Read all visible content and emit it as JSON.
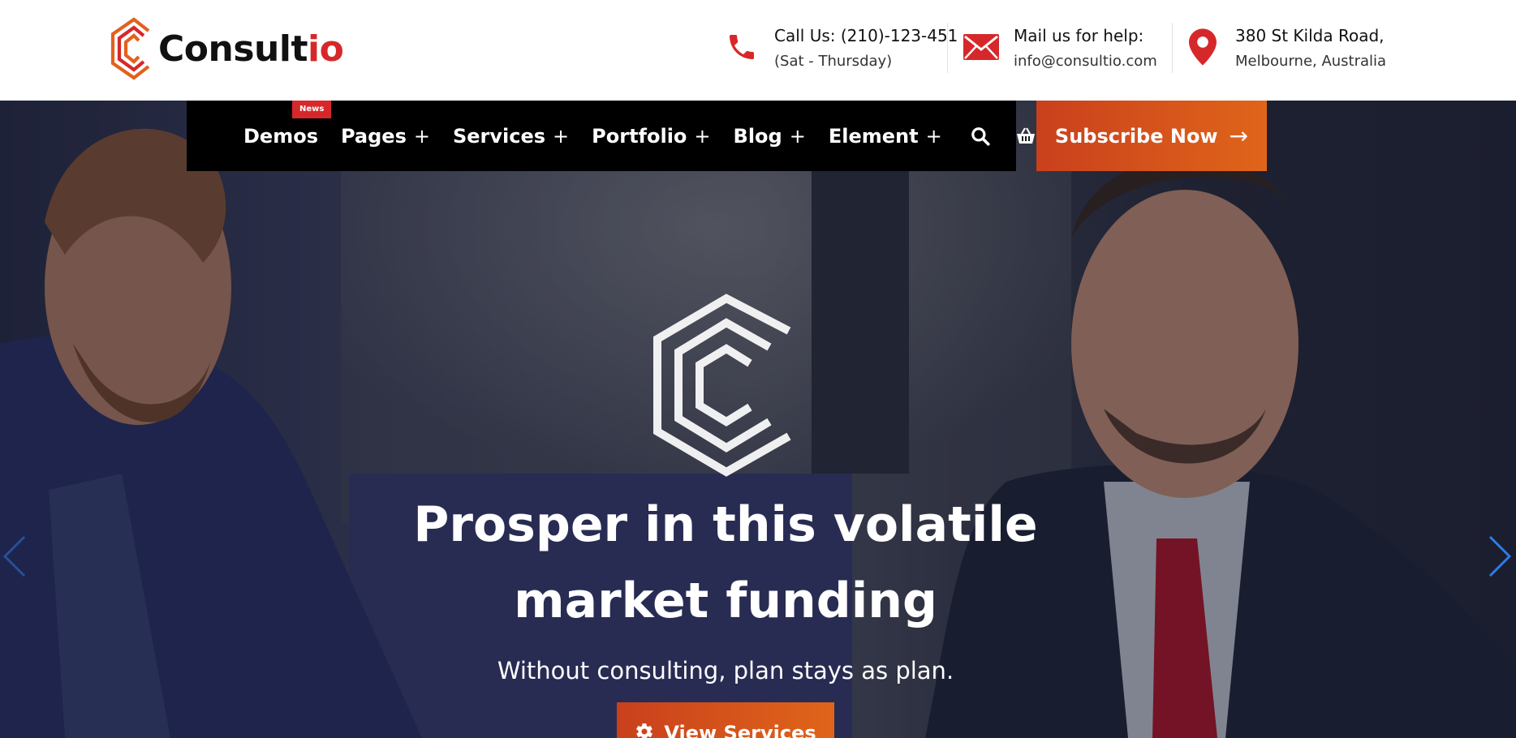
{
  "brand": {
    "name_main": "Consult",
    "name_accent": "io"
  },
  "contact": {
    "phone": {
      "line1": "Call Us: (210)-123-451",
      "line2": "(Sat - Thursday)",
      "icon": "phone-icon"
    },
    "mail": {
      "line1": "Mail us for help:",
      "line2": "info@consultio.com",
      "icon": "mail-icon"
    },
    "location": {
      "line1": "380 St Kilda Road,",
      "line2": "Melbourne, Australia",
      "icon": "map-pin-icon"
    }
  },
  "nav": {
    "items": [
      {
        "label": "Demos",
        "badge": "News",
        "has_submenu": false
      },
      {
        "label": "Pages",
        "plus": "+"
      },
      {
        "label": "Services",
        "plus": "+"
      },
      {
        "label": "Portfolio",
        "plus": "+"
      },
      {
        "label": "Blog",
        "plus": "+"
      },
      {
        "label": "Element",
        "plus": "+"
      }
    ],
    "search_icon": "search-icon",
    "cart_icon": "basket-icon"
  },
  "subscribe": {
    "label": "Subscribe Now",
    "arrow": "→"
  },
  "hero": {
    "title_line1": "Prosper in this volatile",
    "title_line2": "market funding",
    "subtitle": "Without consulting, plan stays as plan.",
    "cta_label": "View Services"
  },
  "colors": {
    "accent": "#d6282a",
    "orange_start": "#c9401c",
    "orange_end": "#e0651a",
    "nav_bg": "#000000",
    "slider_arrow": "#2f7be6"
  }
}
